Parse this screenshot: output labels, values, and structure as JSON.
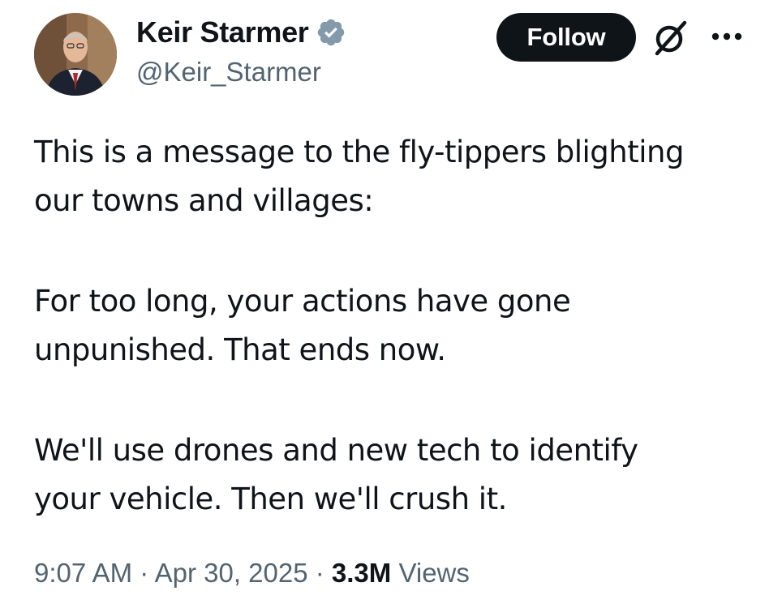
{
  "author": {
    "display_name": "Keir Starmer",
    "handle": "@Keir_Starmer",
    "verified_icon": "verified-badge-icon",
    "avatar_icon": "avatar-photo"
  },
  "actions": {
    "follow_label": "Follow",
    "grok_icon": "grok-icon",
    "more_icon": "more-options-icon"
  },
  "tweet": {
    "paragraphs": [
      {
        "lines": [
          "This is a message to the fly-tippers blighting",
          "our towns and villages:"
        ]
      },
      {
        "lines": [
          "For too long, your actions have gone",
          "unpunished. That ends now."
        ]
      },
      {
        "lines": [
          "We'll use drones and new tech to identify",
          "your vehicle. Then we'll crush it."
        ]
      }
    ]
  },
  "meta": {
    "time": "9:07 AM",
    "separator": " · ",
    "date": "Apr 30, 2025",
    "views_count": "3.3M",
    "views_label": " Views"
  },
  "colors": {
    "text_primary": "#0f1419",
    "text_secondary": "#536471",
    "verified_blue": "#829aab",
    "button_bg": "#0f1419"
  }
}
